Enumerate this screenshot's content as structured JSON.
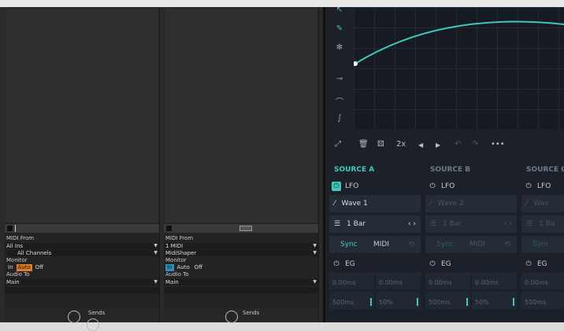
{
  "tracks": [
    {
      "midi_from_label": "MIDI From",
      "midi_from": "All Ins",
      "channel": "All Channels",
      "monitor_label": "Monitor",
      "monitor": [
        "In",
        "Auto",
        "Off"
      ],
      "monitor_active": "Auto",
      "audio_to_label": "Audio To",
      "audio_to": "Main",
      "sends_label": "Sends"
    },
    {
      "midi_from_label": "MIDI From",
      "midi_from": "1 MIDI",
      "channel": "MidiShaper",
      "monitor_label": "Monitor",
      "monitor": [
        "In",
        "Auto",
        "Off"
      ],
      "monitor_active": "In",
      "audio_to_label": "Audio To",
      "audio_to": "Main",
      "sends_label": "Sends"
    }
  ],
  "plugin": {
    "toolbar": {
      "zoom": "2x",
      "more": "•••"
    },
    "sources": [
      {
        "title": "SOURCE A",
        "lfo": "LFO",
        "wave": "Wave 1",
        "rate": "1 Bar",
        "sync": "Sync",
        "midi": "MIDI",
        "eg": "EG",
        "cells1": [
          "0.00ms",
          "0.00ms"
        ],
        "cells2": [
          "500ms",
          "50%"
        ]
      },
      {
        "title": "SOURCE B",
        "lfo": "LFO",
        "wave": "Wave 2",
        "rate": "1 Bar",
        "sync": "Sync",
        "midi": "MIDI",
        "eg": "EG",
        "cells1": [
          "0.00ms",
          "0.00ms"
        ],
        "cells2": [
          "500ms",
          "50%"
        ]
      },
      {
        "title": "SOURCE C",
        "lfo": "LFO",
        "wave": "Wav",
        "rate": "1 Ba",
        "sync": "Sync",
        "midi": "",
        "eg": "EG",
        "cells1": [
          "0.00ms"
        ],
        "cells2": [
          "500ms"
        ]
      }
    ],
    "colors": {
      "accent": "#3ec9bd",
      "panel": "#1b2029"
    }
  }
}
